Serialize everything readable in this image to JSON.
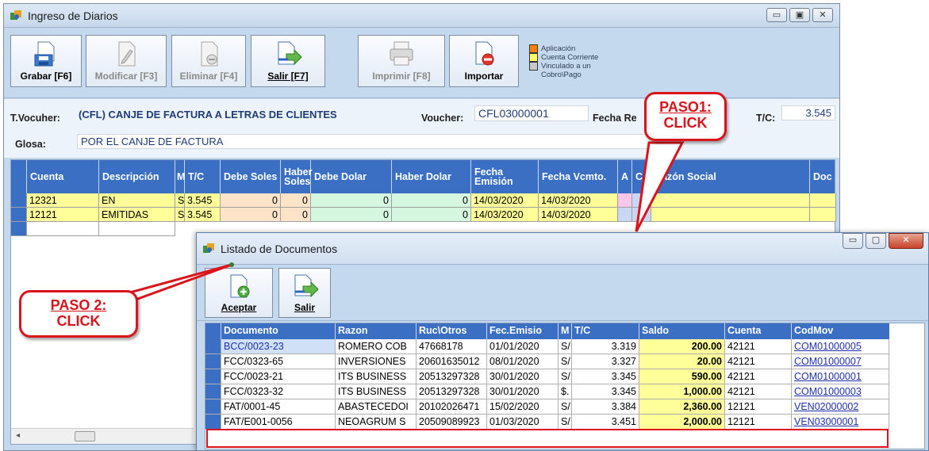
{
  "main_window": {
    "title": "Ingreso de Diarios",
    "toolbar": [
      {
        "label": "Grabar [F6]",
        "enabled": true,
        "icon": "save-icon"
      },
      {
        "label": "Modificar [F3]",
        "enabled": false,
        "icon": "edit-icon"
      },
      {
        "label": "Eliminar [F4]",
        "enabled": false,
        "icon": "delete-icon"
      },
      {
        "label": "Salir [F7]",
        "enabled": true,
        "icon": "exit-icon"
      },
      {
        "label": "Imprimir [F8]",
        "enabled": false,
        "icon": "printer-icon"
      },
      {
        "label": "Importar",
        "enabled": true,
        "icon": "import-icon"
      }
    ],
    "legend": [
      {
        "label": "Aplicación",
        "color": "#ff7f00"
      },
      {
        "label": "Cuenta Corriente",
        "color": "#ffff66"
      },
      {
        "label": "Vinculado a un Cobro\\Pago",
        "color": "#c8c8c8"
      }
    ],
    "form": {
      "tvoucher_label": "T.Vocuher:",
      "tvoucher_value": "(CFL) CANJE DE FACTURA A LETRAS DE CLIENTES",
      "voucher_label": "Voucher:",
      "voucher_value": "CFL03000001",
      "fecha_label": "Fecha Re",
      "tc_label": "T/C:",
      "tc_value": "3.545",
      "glosa_label": "Glosa:",
      "glosa_value": "POR EL CANJE DE FACTURA"
    },
    "grid": {
      "headers": [
        "Cuenta",
        "Descripción",
        "M",
        "T/C",
        "Debe Soles",
        "Haber Soles",
        "Debe Dolar",
        "Haber Dolar",
        "Fecha Emisión",
        "Fecha Vcmto.",
        "A",
        "C",
        "Razón Social",
        "Doc"
      ],
      "rows": [
        {
          "cuenta": "12321",
          "descripcion": "EN",
          "m": "S",
          "tc": "3.545",
          "debe_soles": "0",
          "haber_soles": "0",
          "debe_dolar": "0",
          "haber_dolar": "0",
          "fecha_emision": "14/03/2020",
          "fecha_vcmto": "14/03/2020"
        },
        {
          "cuenta": "12121",
          "descripcion": "EMITIDAS",
          "m": "S",
          "tc": "3.545",
          "debe_soles": "0",
          "haber_soles": "0",
          "debe_dolar": "0",
          "haber_dolar": "0",
          "fecha_emision": "14/03/2020",
          "fecha_vcmto": "14/03/2020"
        }
      ]
    }
  },
  "callouts": {
    "paso1_line1": "PASO1:",
    "paso1_line2": "CLICK",
    "paso2_line1": "PASO 2:",
    "paso2_line2": "CLICK"
  },
  "dialog": {
    "title": "Listado de Documentos",
    "buttons": [
      {
        "label": "Aceptar",
        "icon": "accept-icon"
      },
      {
        "label": "Salir",
        "icon": "exit-icon"
      }
    ],
    "headers": [
      "Documento",
      "Razon",
      "Ruc\\Otros",
      "Fec.Emisio",
      "M",
      "T/C",
      "Saldo",
      "Cuenta",
      "CodMov"
    ],
    "rows": [
      {
        "documento": "BCC/0023-23",
        "razon": "ROMERO COB",
        "ruc": "47668178",
        "fecha": "01/01/2020",
        "m": "S/.",
        "tc": "3.319",
        "saldo": "200.00",
        "cuenta": "42121",
        "codmov": "COM01000005"
      },
      {
        "documento": "FCC/0323-65",
        "razon": "INVERSIONES",
        "ruc": "20601635012",
        "fecha": "08/01/2020",
        "m": "S/.",
        "tc": "3.327",
        "saldo": "20.00",
        "cuenta": "42121",
        "codmov": "COM01000007"
      },
      {
        "documento": "FCC/0023-21",
        "razon": "ITS BUSINESS",
        "ruc": "20513297328",
        "fecha": "30/01/2020",
        "m": "S/.",
        "tc": "3.345",
        "saldo": "590.00",
        "cuenta": "42121",
        "codmov": "COM01000001"
      },
      {
        "documento": "FCC/0323-32",
        "razon": "ITS BUSINESS",
        "ruc": "20513297328",
        "fecha": "30/01/2020",
        "m": "$.",
        "tc": "3.345",
        "saldo": "1,000.00",
        "cuenta": "42121",
        "codmov": "COM01000003"
      },
      {
        "documento": "FAT/0001-45",
        "razon": "ABASTECEDOI",
        "ruc": "20102026471",
        "fecha": "15/02/2020",
        "m": "S/.",
        "tc": "3.384",
        "saldo": "2,360.00",
        "cuenta": "12121",
        "codmov": "VEN02000002"
      },
      {
        "documento": "FAT/E001-0056",
        "razon": "NEOAGRUM S",
        "ruc": "20509089923",
        "fecha": "01/03/2020",
        "m": "S/.",
        "tc": "3.451",
        "saldo": "2,000.00",
        "cuenta": "12121",
        "codmov": "VEN03000001"
      }
    ]
  }
}
